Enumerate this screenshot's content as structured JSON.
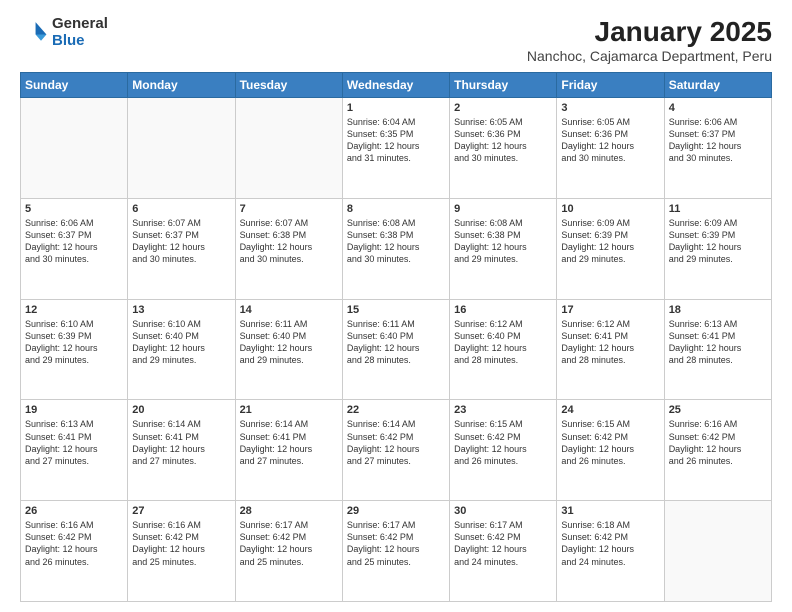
{
  "header": {
    "logo": {
      "general": "General",
      "blue": "Blue"
    },
    "title": "January 2025",
    "subtitle": "Nanchoc, Cajamarca Department, Peru"
  },
  "weekdays": [
    "Sunday",
    "Monday",
    "Tuesday",
    "Wednesday",
    "Thursday",
    "Friday",
    "Saturday"
  ],
  "weeks": [
    [
      {
        "day": "",
        "info": ""
      },
      {
        "day": "",
        "info": ""
      },
      {
        "day": "",
        "info": ""
      },
      {
        "day": "1",
        "info": "Sunrise: 6:04 AM\nSunset: 6:35 PM\nDaylight: 12 hours\nand 31 minutes."
      },
      {
        "day": "2",
        "info": "Sunrise: 6:05 AM\nSunset: 6:36 PM\nDaylight: 12 hours\nand 30 minutes."
      },
      {
        "day": "3",
        "info": "Sunrise: 6:05 AM\nSunset: 6:36 PM\nDaylight: 12 hours\nand 30 minutes."
      },
      {
        "day": "4",
        "info": "Sunrise: 6:06 AM\nSunset: 6:37 PM\nDaylight: 12 hours\nand 30 minutes."
      }
    ],
    [
      {
        "day": "5",
        "info": "Sunrise: 6:06 AM\nSunset: 6:37 PM\nDaylight: 12 hours\nand 30 minutes."
      },
      {
        "day": "6",
        "info": "Sunrise: 6:07 AM\nSunset: 6:37 PM\nDaylight: 12 hours\nand 30 minutes."
      },
      {
        "day": "7",
        "info": "Sunrise: 6:07 AM\nSunset: 6:38 PM\nDaylight: 12 hours\nand 30 minutes."
      },
      {
        "day": "8",
        "info": "Sunrise: 6:08 AM\nSunset: 6:38 PM\nDaylight: 12 hours\nand 30 minutes."
      },
      {
        "day": "9",
        "info": "Sunrise: 6:08 AM\nSunset: 6:38 PM\nDaylight: 12 hours\nand 29 minutes."
      },
      {
        "day": "10",
        "info": "Sunrise: 6:09 AM\nSunset: 6:39 PM\nDaylight: 12 hours\nand 29 minutes."
      },
      {
        "day": "11",
        "info": "Sunrise: 6:09 AM\nSunset: 6:39 PM\nDaylight: 12 hours\nand 29 minutes."
      }
    ],
    [
      {
        "day": "12",
        "info": "Sunrise: 6:10 AM\nSunset: 6:39 PM\nDaylight: 12 hours\nand 29 minutes."
      },
      {
        "day": "13",
        "info": "Sunrise: 6:10 AM\nSunset: 6:40 PM\nDaylight: 12 hours\nand 29 minutes."
      },
      {
        "day": "14",
        "info": "Sunrise: 6:11 AM\nSunset: 6:40 PM\nDaylight: 12 hours\nand 29 minutes."
      },
      {
        "day": "15",
        "info": "Sunrise: 6:11 AM\nSunset: 6:40 PM\nDaylight: 12 hours\nand 28 minutes."
      },
      {
        "day": "16",
        "info": "Sunrise: 6:12 AM\nSunset: 6:40 PM\nDaylight: 12 hours\nand 28 minutes."
      },
      {
        "day": "17",
        "info": "Sunrise: 6:12 AM\nSunset: 6:41 PM\nDaylight: 12 hours\nand 28 minutes."
      },
      {
        "day": "18",
        "info": "Sunrise: 6:13 AM\nSunset: 6:41 PM\nDaylight: 12 hours\nand 28 minutes."
      }
    ],
    [
      {
        "day": "19",
        "info": "Sunrise: 6:13 AM\nSunset: 6:41 PM\nDaylight: 12 hours\nand 27 minutes."
      },
      {
        "day": "20",
        "info": "Sunrise: 6:14 AM\nSunset: 6:41 PM\nDaylight: 12 hours\nand 27 minutes."
      },
      {
        "day": "21",
        "info": "Sunrise: 6:14 AM\nSunset: 6:41 PM\nDaylight: 12 hours\nand 27 minutes."
      },
      {
        "day": "22",
        "info": "Sunrise: 6:14 AM\nSunset: 6:42 PM\nDaylight: 12 hours\nand 27 minutes."
      },
      {
        "day": "23",
        "info": "Sunrise: 6:15 AM\nSunset: 6:42 PM\nDaylight: 12 hours\nand 26 minutes."
      },
      {
        "day": "24",
        "info": "Sunrise: 6:15 AM\nSunset: 6:42 PM\nDaylight: 12 hours\nand 26 minutes."
      },
      {
        "day": "25",
        "info": "Sunrise: 6:16 AM\nSunset: 6:42 PM\nDaylight: 12 hours\nand 26 minutes."
      }
    ],
    [
      {
        "day": "26",
        "info": "Sunrise: 6:16 AM\nSunset: 6:42 PM\nDaylight: 12 hours\nand 26 minutes."
      },
      {
        "day": "27",
        "info": "Sunrise: 6:16 AM\nSunset: 6:42 PM\nDaylight: 12 hours\nand 25 minutes."
      },
      {
        "day": "28",
        "info": "Sunrise: 6:17 AM\nSunset: 6:42 PM\nDaylight: 12 hours\nand 25 minutes."
      },
      {
        "day": "29",
        "info": "Sunrise: 6:17 AM\nSunset: 6:42 PM\nDaylight: 12 hours\nand 25 minutes."
      },
      {
        "day": "30",
        "info": "Sunrise: 6:17 AM\nSunset: 6:42 PM\nDaylight: 12 hours\nand 24 minutes."
      },
      {
        "day": "31",
        "info": "Sunrise: 6:18 AM\nSunset: 6:42 PM\nDaylight: 12 hours\nand 24 minutes."
      },
      {
        "day": "",
        "info": ""
      }
    ]
  ]
}
